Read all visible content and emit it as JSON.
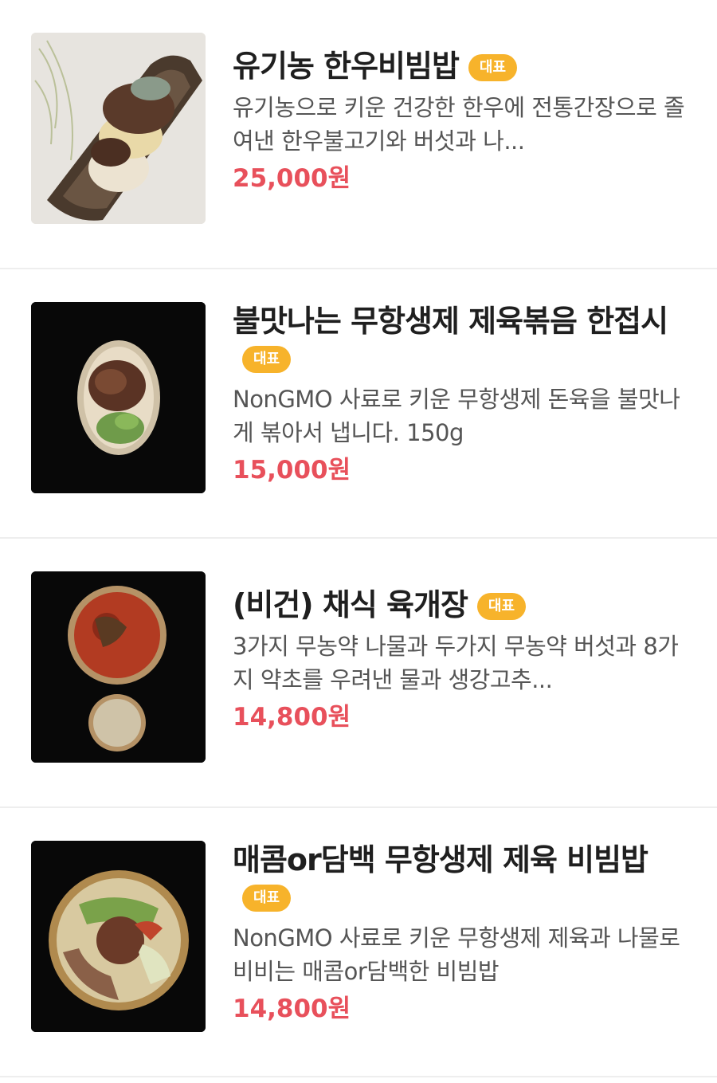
{
  "menu": {
    "items": [
      {
        "image": "bibimbap-on-wooden-plate",
        "title": "유기농 한우비빔밥",
        "badge": "대표",
        "description": "유기농으로 키운 건강한 한우에 전통간장으로 졸여낸 한우불고기와 버섯과 나...",
        "price": "25,000원"
      },
      {
        "image": "stir-fried-pork-on-oval-plate",
        "title": "불맛나는 무항생제 제육볶음 한접시",
        "badge": "대표",
        "description": "NonGMO 사료로 키운 무항생제 돈육을 불맛나게 볶아서 냅니다. 150g",
        "price": "15,000원"
      },
      {
        "image": "vegan-yukgaejang-with-rice-bowl",
        "title": "(비건) 채식 육개장",
        "badge": "대표",
        "description": "3가지 무농약 나물과 두가지 무농약 버섯과 8가지 약초를 우려낸 물과 생강고추...",
        "price": "14,800원"
      },
      {
        "image": "pork-bibimbap-in-brass-bowl",
        "title": "매콤or담백 무항생제 제육 비빔밥",
        "badge": "대표",
        "description": "NonGMO 사료로 키운 무항생제 제육과 나물로 비비는 매콤or담백한 비빔밥",
        "price": "14,800원"
      }
    ]
  },
  "colors": {
    "badge_bg": "#f7b32b",
    "price": "#e8505b",
    "divider": "#eeeeee"
  }
}
